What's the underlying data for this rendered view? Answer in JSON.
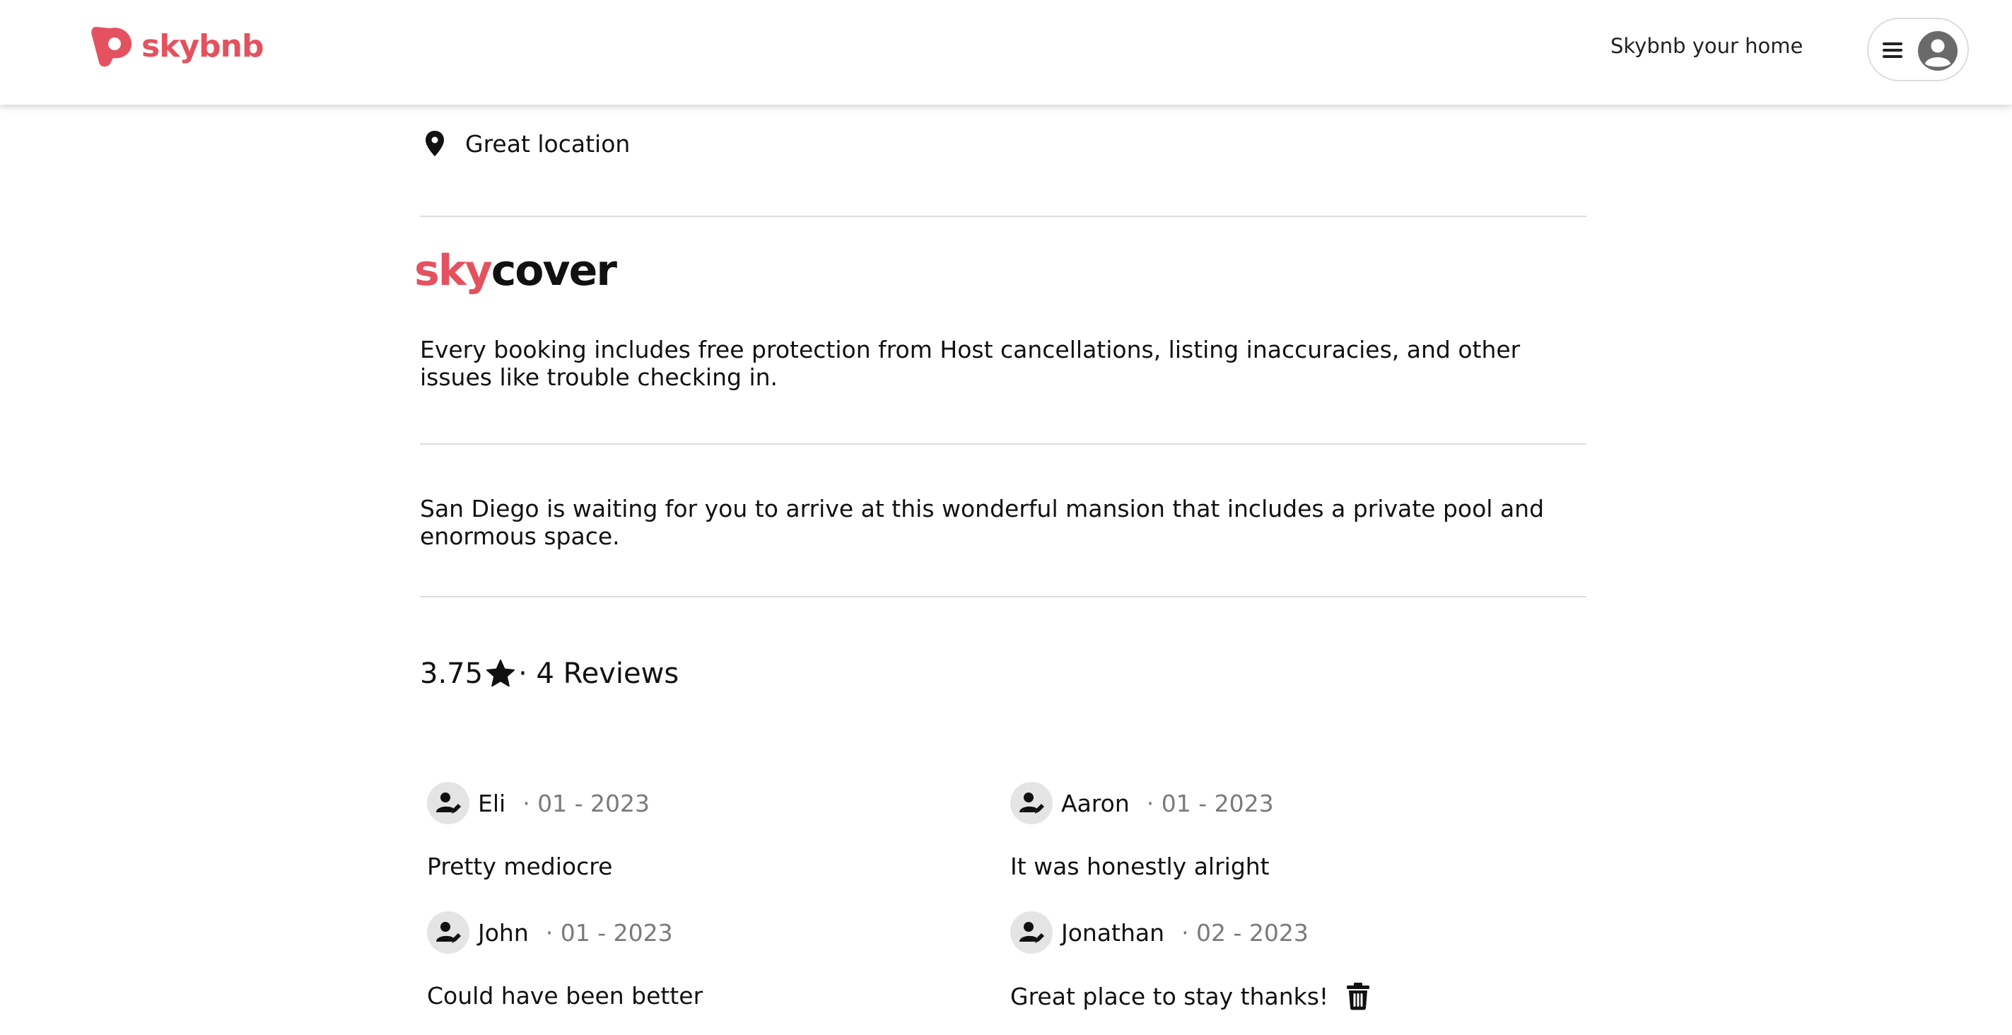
{
  "brand": {
    "name": "skybnb",
    "color": "#e4515f"
  },
  "nav": {
    "host_link": "Skybnb your home",
    "menu_icon": "hamburger-icon",
    "avatar_icon": "user-avatar-icon"
  },
  "highlights": {
    "location_icon": "map-pin-icon",
    "location_text": "Great location"
  },
  "skycover": {
    "prefix": "sky",
    "suffix": "cover",
    "description": "Every booking includes free protection from Host cancellations, listing inaccuracies, and other issues like trouble checking in."
  },
  "listing": {
    "description": "San Diego is waiting for you to arrive at this wonderful mansion that includes a private pool and enormous space."
  },
  "rating": {
    "score": "3.75",
    "star_icon": "star-icon",
    "reviews_label": "· 4 Reviews"
  },
  "reviews": [
    {
      "name": "Eli",
      "date": "· 01 - 2023",
      "text": "Pretty mediocre"
    },
    {
      "name": "Aaron",
      "date": "· 01 - 2023",
      "text": "It was honestly alright"
    },
    {
      "name": "John",
      "date": "· 01 - 2023",
      "text": "Could have been better"
    },
    {
      "name": "Jonathan",
      "date": "· 02 - 2023",
      "text": "Great place to stay thanks!",
      "deletable": true
    }
  ]
}
